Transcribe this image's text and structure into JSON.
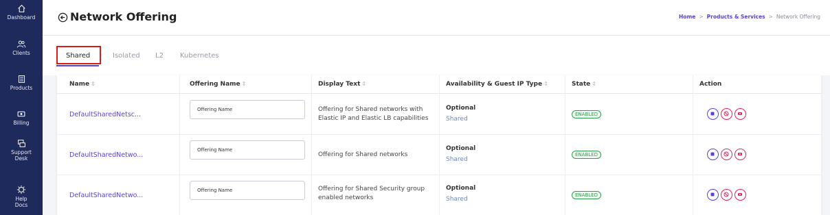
{
  "sidebar": {
    "items": [
      {
        "label": "Dashboard",
        "icon": "home-icon"
      },
      {
        "label": "Clients",
        "icon": "users-icon"
      },
      {
        "label": "Products",
        "icon": "products-icon"
      },
      {
        "label": "Billing",
        "icon": "billing-icon"
      },
      {
        "label": "Support Desk",
        "icon": "support-icon"
      },
      {
        "label": "Help Docs",
        "icon": "help-icon"
      }
    ]
  },
  "header": {
    "title": "Network Offering",
    "breadcrumb": {
      "home": "Home",
      "products": "Products & Services",
      "current": "Network Offering"
    }
  },
  "tabs": [
    {
      "label": "Shared",
      "active": true
    },
    {
      "label": "Isolated",
      "active": false
    },
    {
      "label": "L2",
      "active": false
    },
    {
      "label": "Kubernetes",
      "active": false
    }
  ],
  "table": {
    "columns": [
      "Name",
      "Offering Name",
      "Display Text",
      "Availability & Guest IP Type",
      "State",
      "Action"
    ],
    "rows": [
      {
        "name": "DefaultSharedNetsc...",
        "offering_placeholder": "Offering Name",
        "display_line1": "Offering for Shared networks with",
        "display_line2": "Elastic IP and Elastic LB capabilities",
        "availability": "Optional",
        "guest_ip": "Shared",
        "state": "ENABLED"
      },
      {
        "name": "DefaultSharedNetwo...",
        "offering_placeholder": "Offering Name",
        "display_line1": "Offering for Shared networks",
        "display_line2": "",
        "availability": "Optional",
        "guest_ip": "Shared",
        "state": "ENABLED"
      },
      {
        "name": "DefaultSharedNetwo...",
        "offering_placeholder": "Offering Name",
        "display_line1": "Offering for Shared Security group",
        "display_line2": "enabled networks",
        "availability": "Optional",
        "guest_ip": "Shared",
        "state": "ENABLED"
      }
    ]
  },
  "colors": {
    "sidebar_bg": "#1f2a5c",
    "accent": "#5b3fd9",
    "enabled": "#2e9e4b",
    "danger": "#e0245e",
    "highlight": "#d81b1b"
  }
}
